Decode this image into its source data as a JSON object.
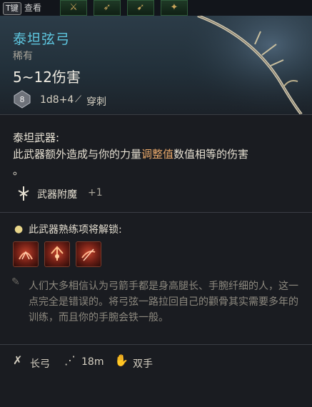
{
  "topbar": {
    "key_badge": "T键",
    "key_action": "查看",
    "slot_icons": [
      "sword-slot-icon",
      "bow-slot-icon",
      "arrow-slot-icon",
      "staff-slot-icon"
    ]
  },
  "item": {
    "name": "泰坦弦弓",
    "rarity": "稀有",
    "damage": "5~12伤害",
    "dice_label": "8",
    "dice_roll": "1d8+4",
    "damage_type": "穿刺"
  },
  "property": {
    "title": "泰坦武器:",
    "body_prefix": "此武器额外造成与你的力量",
    "body_highlight": "调整值",
    "body_suffix": "数值相等的伤害",
    "body_end": "。"
  },
  "enchant": {
    "label": "武器附魔",
    "bonus": "+1"
  },
  "proficiency": {
    "label": "此武器熟练项将解锁:",
    "abilities": [
      "ability-icon-1",
      "ability-icon-2",
      "ability-icon-3"
    ]
  },
  "lore": {
    "text": "人们大多相信认为弓箭手都是身高腿长、手腕纤细的人，这一点完全是错误的。将弓弦一路拉回自己的颧骨其实需要多年的训练，而且你的手腕会铁一般。"
  },
  "footer": {
    "weapon_type": "长弓",
    "range": "18m",
    "handedness": "双手"
  },
  "colors": {
    "item_name": "#5ec7e0",
    "highlight": "#e8a86a",
    "background": "#1a1c21"
  }
}
